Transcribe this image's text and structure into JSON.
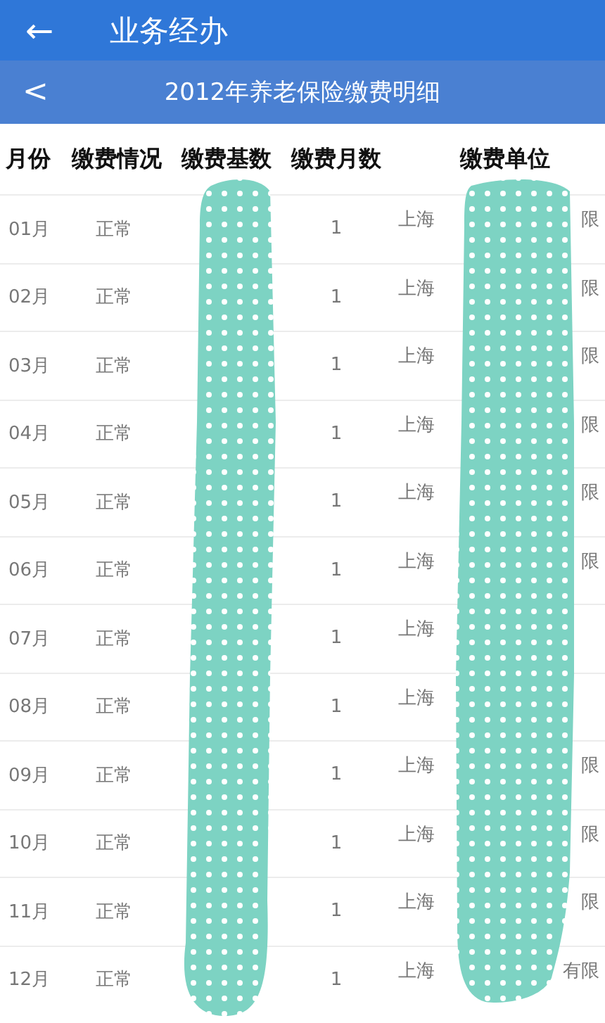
{
  "app_bar": {
    "back_icon": "←",
    "title": "业务经办"
  },
  "sub_bar": {
    "back_icon": "<",
    "title": "2012年养老保险缴费明细"
  },
  "table": {
    "columns": [
      "月份",
      "缴费情况",
      "缴费基数",
      "缴费月数",
      "缴费单位"
    ],
    "rows": [
      {
        "month": "01月",
        "status": "正常",
        "count": "1",
        "unit_start": "上海",
        "unit_end": "限"
      },
      {
        "month": "02月",
        "status": "正常",
        "count": "1",
        "unit_start": "上海",
        "unit_end": "限"
      },
      {
        "month": "03月",
        "status": "正常",
        "count": "1",
        "unit_start": "上海",
        "unit_end": "限"
      },
      {
        "month": "04月",
        "status": "正常",
        "count": "1",
        "unit_start": "上海",
        "unit_end": "限"
      },
      {
        "month": "05月",
        "status": "正常",
        "count": "1",
        "unit_start": "上海",
        "unit_end": "限"
      },
      {
        "month": "06月",
        "status": "正常",
        "count": "1",
        "unit_start": "上海",
        "unit_end": "限"
      },
      {
        "month": "07月",
        "status": "正常",
        "count": "1",
        "unit_start": "上海"
      },
      {
        "month": "08月",
        "status": "正常",
        "count": "1",
        "unit_start": "上海"
      },
      {
        "month": "09月",
        "status": "正常",
        "count": "1",
        "unit_start": "上海",
        "unit_end": "限"
      },
      {
        "month": "10月",
        "status": "正常",
        "count": "1",
        "unit_start": "上海",
        "unit_end": "限"
      },
      {
        "month": "11月",
        "status": "正常",
        "count": "1",
        "unit_start": "上海",
        "unit_end": "限"
      },
      {
        "month": "12月",
        "status": "正常",
        "count": "1",
        "unit_start": "上海",
        "unit_end": "有限"
      }
    ]
  }
}
